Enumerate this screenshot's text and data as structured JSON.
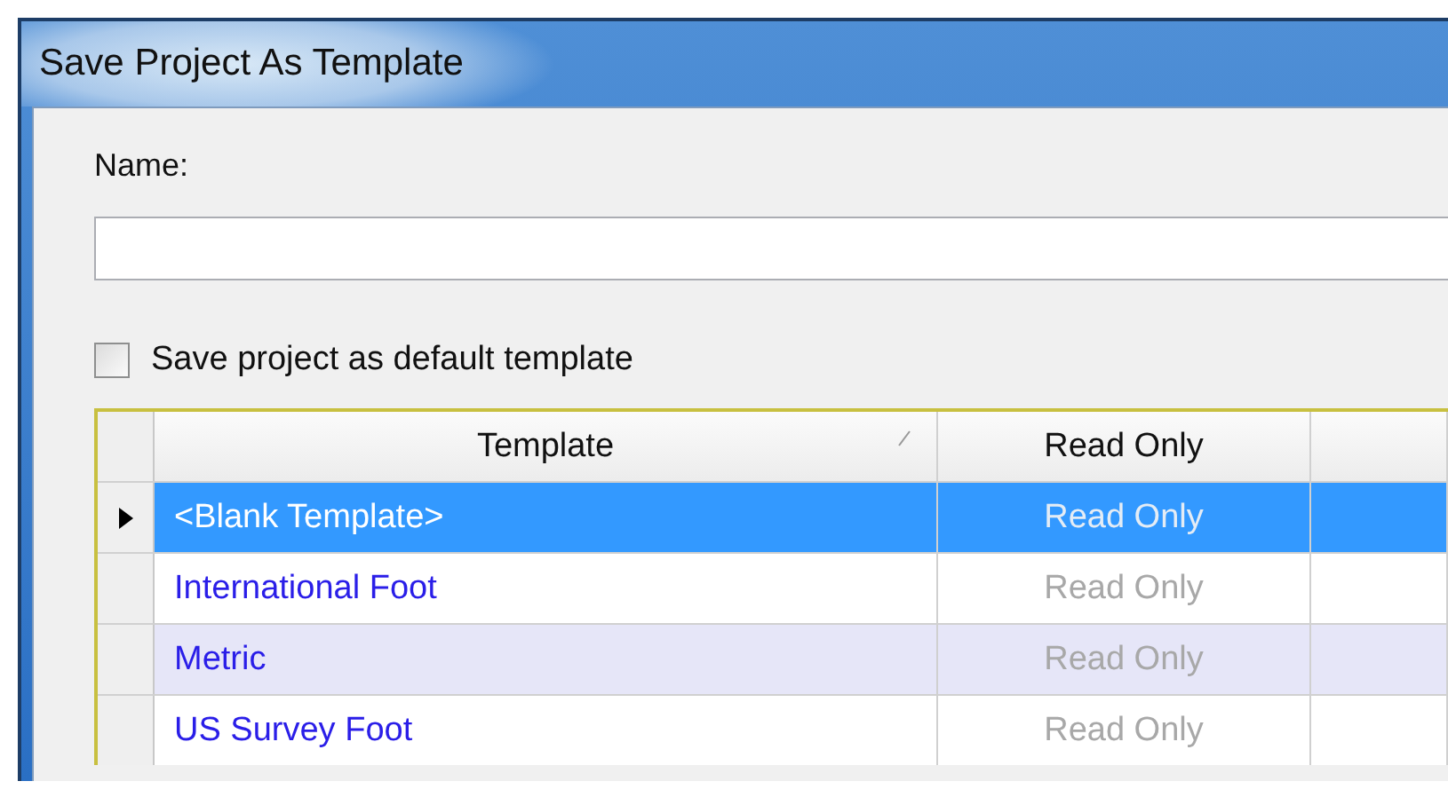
{
  "window": {
    "title": "Save Project As Template"
  },
  "name_field": {
    "label": "Name:"
  },
  "default_checkbox": {
    "label": "Save project as default template",
    "checked": false
  },
  "table": {
    "columns": [
      "Template",
      "Read Only"
    ],
    "rows": [
      {
        "template": "<Blank Template>",
        "read_only": "Read Only",
        "selected": true
      },
      {
        "template": "International Foot",
        "read_only": "Read Only",
        "selected": false
      },
      {
        "template": "Metric",
        "read_only": "Read Only",
        "selected": false
      },
      {
        "template": "US Survey Foot",
        "read_only": "Read Only",
        "selected": false
      }
    ]
  }
}
